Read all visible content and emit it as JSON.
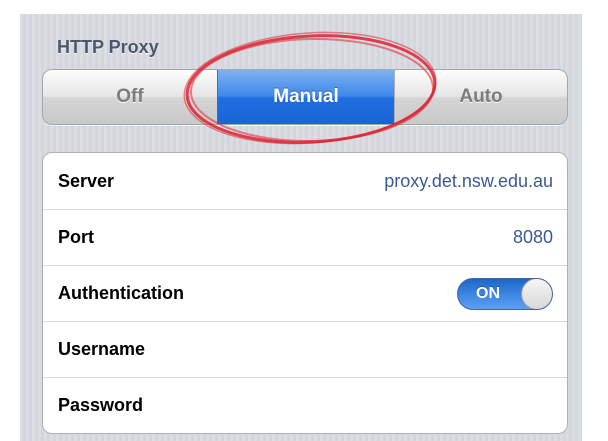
{
  "http_proxy": {
    "header": "HTTP Proxy",
    "mode_options": [
      "Off",
      "Manual",
      "Auto"
    ],
    "selected_mode": "Manual"
  },
  "settings": {
    "server": {
      "label": "Server",
      "value": "proxy.det.nsw.edu.au"
    },
    "port": {
      "label": "Port",
      "value": "8080"
    },
    "authentication": {
      "label": "Authentication",
      "toggle_text": "ON",
      "enabled": true
    },
    "username": {
      "label": "Username",
      "value": ""
    },
    "password": {
      "label": "Password",
      "value": ""
    }
  },
  "colors": {
    "selected_segment": "#2f7de6",
    "value_text": "#3b5a94",
    "annotation": "#e0202e"
  }
}
